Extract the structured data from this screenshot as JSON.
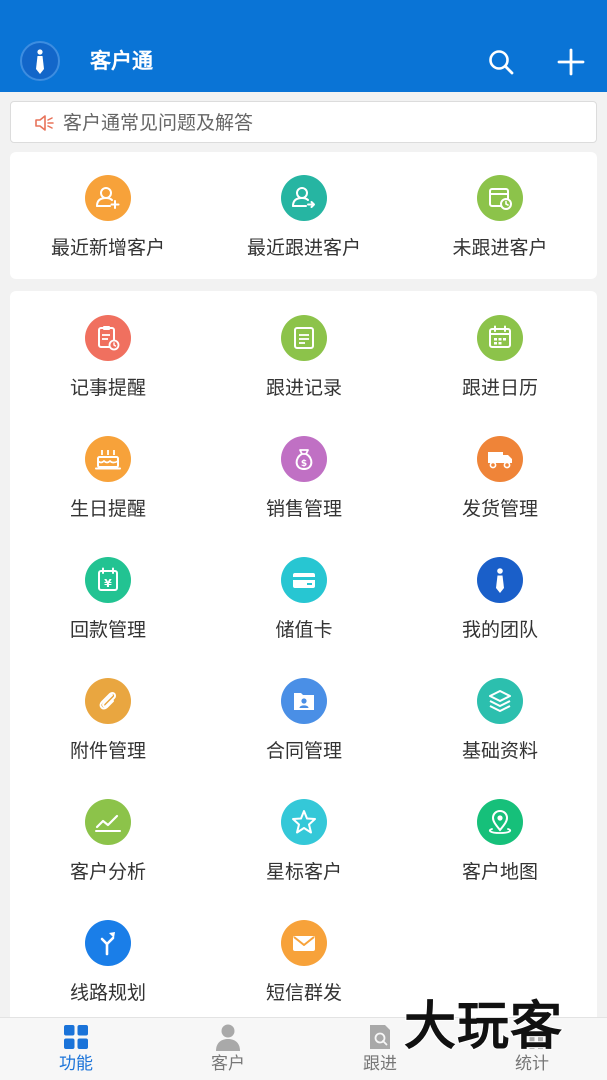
{
  "header": {
    "title": "客户通",
    "logo_icon": "necktie-icon",
    "actions": [
      {
        "name": "search",
        "icon": "search-icon"
      },
      {
        "name": "add",
        "icon": "plus-icon"
      }
    ],
    "background": "#0a74d6"
  },
  "notice": {
    "icon": "speaker-icon",
    "text": "客户通常见问题及解答"
  },
  "quick_section": [
    {
      "label": "最近新增客户",
      "icon": "user-add-icon",
      "color": "#f7a23a"
    },
    {
      "label": "最近跟进客户",
      "icon": "user-forward-icon",
      "color": "#26b5a2"
    },
    {
      "label": "未跟进客户",
      "icon": "calendar-clock-icon",
      "color": "#8cc34a"
    }
  ],
  "grid": [
    {
      "label": "记事提醒",
      "icon": "clipboard-clock-icon",
      "color": "#f0705f"
    },
    {
      "label": "跟进记录",
      "icon": "notes-icon",
      "color": "#8cc34a"
    },
    {
      "label": "跟进日历",
      "icon": "calendar-icon",
      "color": "#8cc34a"
    },
    {
      "label": "生日提醒",
      "icon": "cake-icon",
      "color": "#f7a23a"
    },
    {
      "label": "销售管理",
      "icon": "money-bag-icon",
      "color": "#c070c4"
    },
    {
      "label": "发货管理",
      "icon": "truck-icon",
      "color": "#ef8438"
    },
    {
      "label": "回款管理",
      "icon": "yen-calendar-icon",
      "color": "#22c392"
    },
    {
      "label": "储值卡",
      "icon": "card-icon",
      "color": "#27c6d2"
    },
    {
      "label": "我的团队",
      "icon": "necktie-icon",
      "color": "#1a5fc9"
    },
    {
      "label": "附件管理",
      "icon": "paperclip-icon",
      "color": "#e9a640"
    },
    {
      "label": "合同管理",
      "icon": "contract-icon",
      "color": "#4a8fe6"
    },
    {
      "label": "基础资料",
      "icon": "layers-icon",
      "color": "#2cbfae"
    },
    {
      "label": "客户分析",
      "icon": "line-chart-icon",
      "color": "#8cc34a"
    },
    {
      "label": "星标客户",
      "icon": "star-icon",
      "color": "#34c8d8"
    },
    {
      "label": "客户地图",
      "icon": "map-pin-icon",
      "color": "#16c07a"
    },
    {
      "label": "线路规划",
      "icon": "route-icon",
      "color": "#1a7ee8"
    },
    {
      "label": "短信群发",
      "icon": "envelope-icon",
      "color": "#f7a23a"
    }
  ],
  "tabbar": {
    "active_color": "#1a73d9",
    "tabs": [
      {
        "label": "功能",
        "icon": "grid-icon",
        "active": true
      },
      {
        "label": "客户",
        "icon": "person-icon",
        "active": false
      },
      {
        "label": "跟进",
        "icon": "document-icon",
        "active": false
      },
      {
        "label": "统计",
        "icon": "bar-chart-icon",
        "active": false
      }
    ]
  },
  "watermark": "大玩客"
}
